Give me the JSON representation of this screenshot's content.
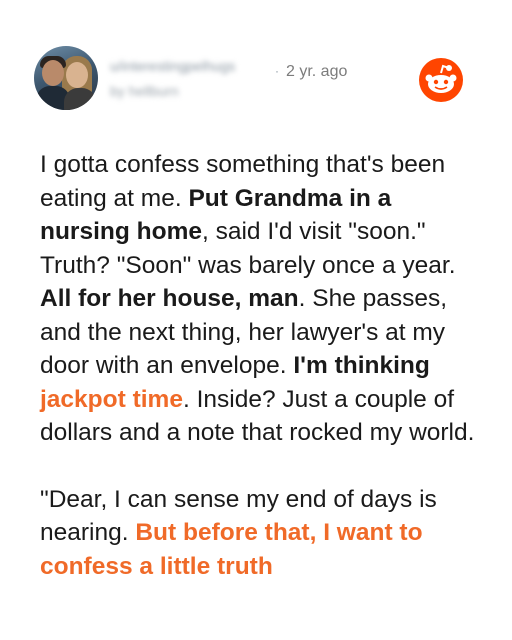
{
  "post": {
    "username": "u/interestingpelhugs",
    "byline": "by hellburn",
    "separator": "·",
    "time": "2 yr. ago",
    "paragraph1": [
      {
        "t": "I gotta confess something that's been eating at me. ",
        "style": "normal"
      },
      {
        "t": "Put Grandma in a nursing home",
        "style": "bold"
      },
      {
        "t": ", said I'd visit \"soon.\" Truth? \"Soon\" was barely once a year. ",
        "style": "normal"
      },
      {
        "t": "All for her house, man",
        "style": "bold"
      },
      {
        "t": ". She passes, and the next thing, her lawyer's at my door with an envelope. ",
        "style": "normal"
      },
      {
        "t": "I'm thinking ",
        "style": "bold"
      },
      {
        "t": "jackpot time",
        "style": "orange"
      },
      {
        "t": ". Inside? Just a couple of dollars and a note that rocked my world.",
        "style": "normal"
      }
    ],
    "paragraph2": [
      {
        "t": "\"Dear, I can sense my end of days is nearing. ",
        "style": "normal"
      },
      {
        "t": "But before that, I want to confess a little truth",
        "style": "orange"
      }
    ]
  },
  "colors": {
    "accent_orange": "#f06a28",
    "reddit_orange": "#ff4500",
    "meta_gray": "#7c7c7c"
  },
  "icons": {
    "reddit_logo": "reddit-snoo-icon"
  }
}
